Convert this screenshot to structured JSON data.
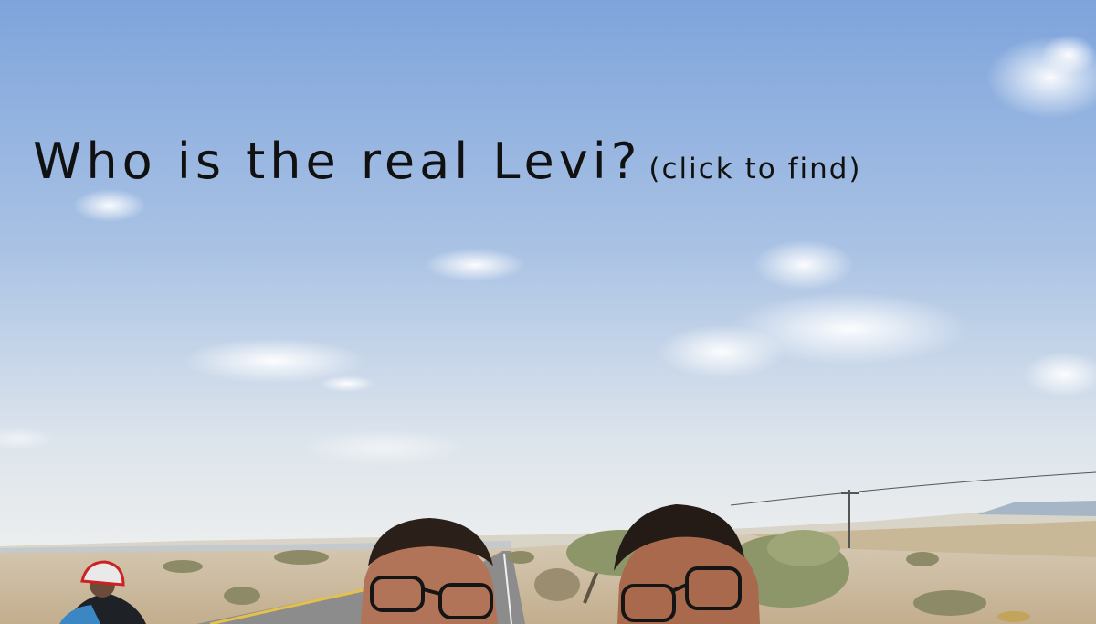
{
  "headline": {
    "question": "Who is the real Levi?",
    "hint": "(click to find)"
  },
  "colors": {
    "sky_top": "#7da3dc",
    "sky_horizon": "#e8ecef",
    "ground": "#cdbfa8",
    "road": "#8f8f8f",
    "text": "#111111"
  }
}
